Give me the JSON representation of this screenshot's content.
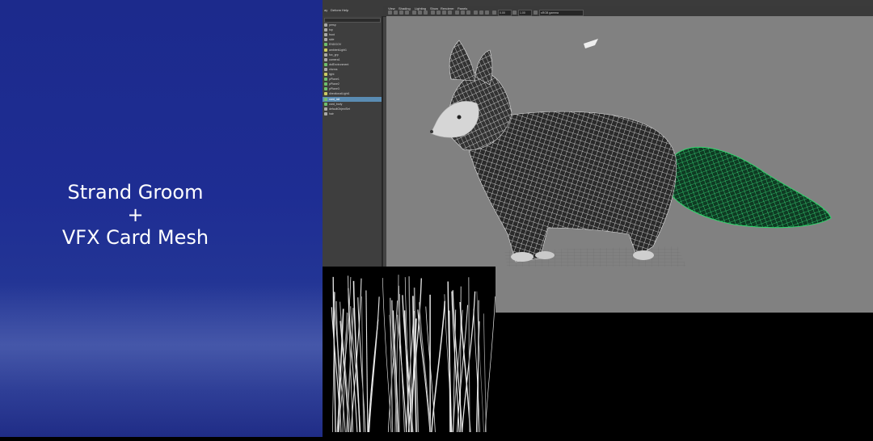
{
  "slide": {
    "title_lines": [
      "Strand Groom",
      "+",
      "VFX Card Mesh"
    ]
  },
  "maya": {
    "menubar": [
      "ay",
      "Deform",
      "Help"
    ],
    "viewport_menu": [
      "View",
      "Shading",
      "Lighting",
      "Show",
      "Renderer",
      "Panels"
    ],
    "field_values": [
      "0.00",
      "1.00"
    ],
    "camera_field": "sRGB gamma",
    "outliner_items": [
      {
        "label": "persp",
        "color": "#aaaaaa"
      },
      {
        "label": "top",
        "color": "#aaaaaa"
      },
      {
        "label": "front",
        "color": "#aaaaaa"
      },
      {
        "label": "side",
        "color": "#aaaaaa"
      },
      {
        "label": "ENDGOV",
        "color": "#6fbf6f"
      },
      {
        "label": "ambientLight1",
        "color": "#cccc66"
      },
      {
        "label": "fox_grp",
        "color": "#aaaaaa"
      },
      {
        "label": "camera1",
        "color": "#aaaaaa"
      },
      {
        "label": "dsfEnvironment",
        "color": "#6fbf6f"
      },
      {
        "label": "xforms",
        "color": "#aaaaaa"
      },
      {
        "label": "light",
        "color": "#cccc66"
      },
      {
        "label": "pPlane1",
        "color": "#6fbf6f"
      },
      {
        "label": "pPlane2",
        "color": "#6fbf6f"
      },
      {
        "label": "pPlane3",
        "color": "#6fbf6f"
      },
      {
        "label": "directionalLight1",
        "color": "#cccc66"
      },
      {
        "label": "card_tail",
        "color": "#6fbf6f",
        "selected": true
      },
      {
        "label": "card_body",
        "color": "#6fbf6f"
      },
      {
        "label": "defaultObjectSet",
        "color": "#aaaaaa"
      },
      {
        "label": "hair",
        "color": "#aaaaaa"
      }
    ]
  },
  "colors": {
    "slide_blue": "#1e2d93",
    "viewport_gray": "#818181",
    "selection_green": "#2fd46a",
    "wire_white": "#f2f2f2"
  }
}
